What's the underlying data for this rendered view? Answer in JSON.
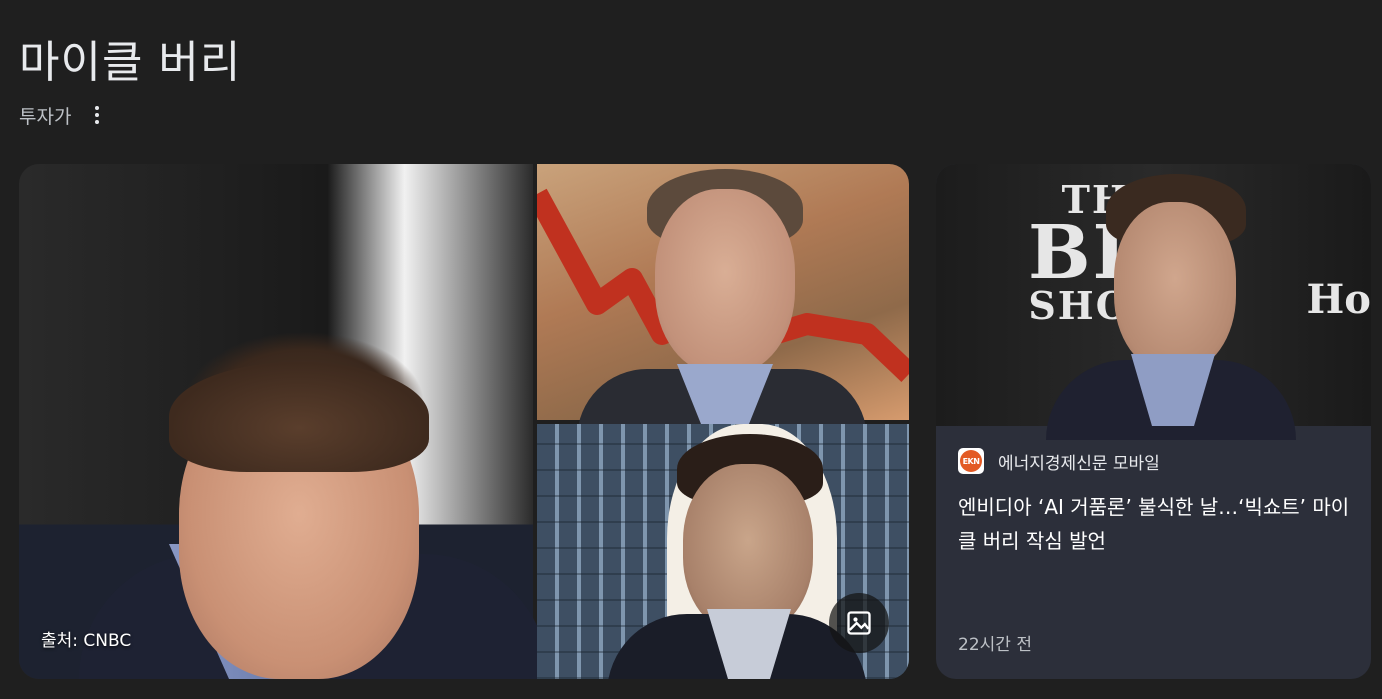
{
  "entity": {
    "title": "마이클 버리",
    "subtitle": "투자가",
    "more_icon": "more-vert-icon"
  },
  "gallery": {
    "main_image_source": "출처: CNBC",
    "image_button_icon": "image-icon"
  },
  "news": {
    "publisher_logo_text": "EKN",
    "publisher": "에너지경제신문 모바일",
    "headline": "엔비디아 ‘AI 거품론’ 불식한 날…‘빅쇼트’ 마이클 버리 작심 발언",
    "time": "22시간 전",
    "poster_line1": "THE",
    "poster_line2": "BIG",
    "poster_line3": "SHORT",
    "poster_side": "Ho"
  },
  "colors": {
    "background": "#1f1f1f",
    "card": "#2c2f3a",
    "text_primary": "#e8eaed",
    "text_secondary": "#bdc1c6",
    "publisher_logo": "#e35a24"
  }
}
